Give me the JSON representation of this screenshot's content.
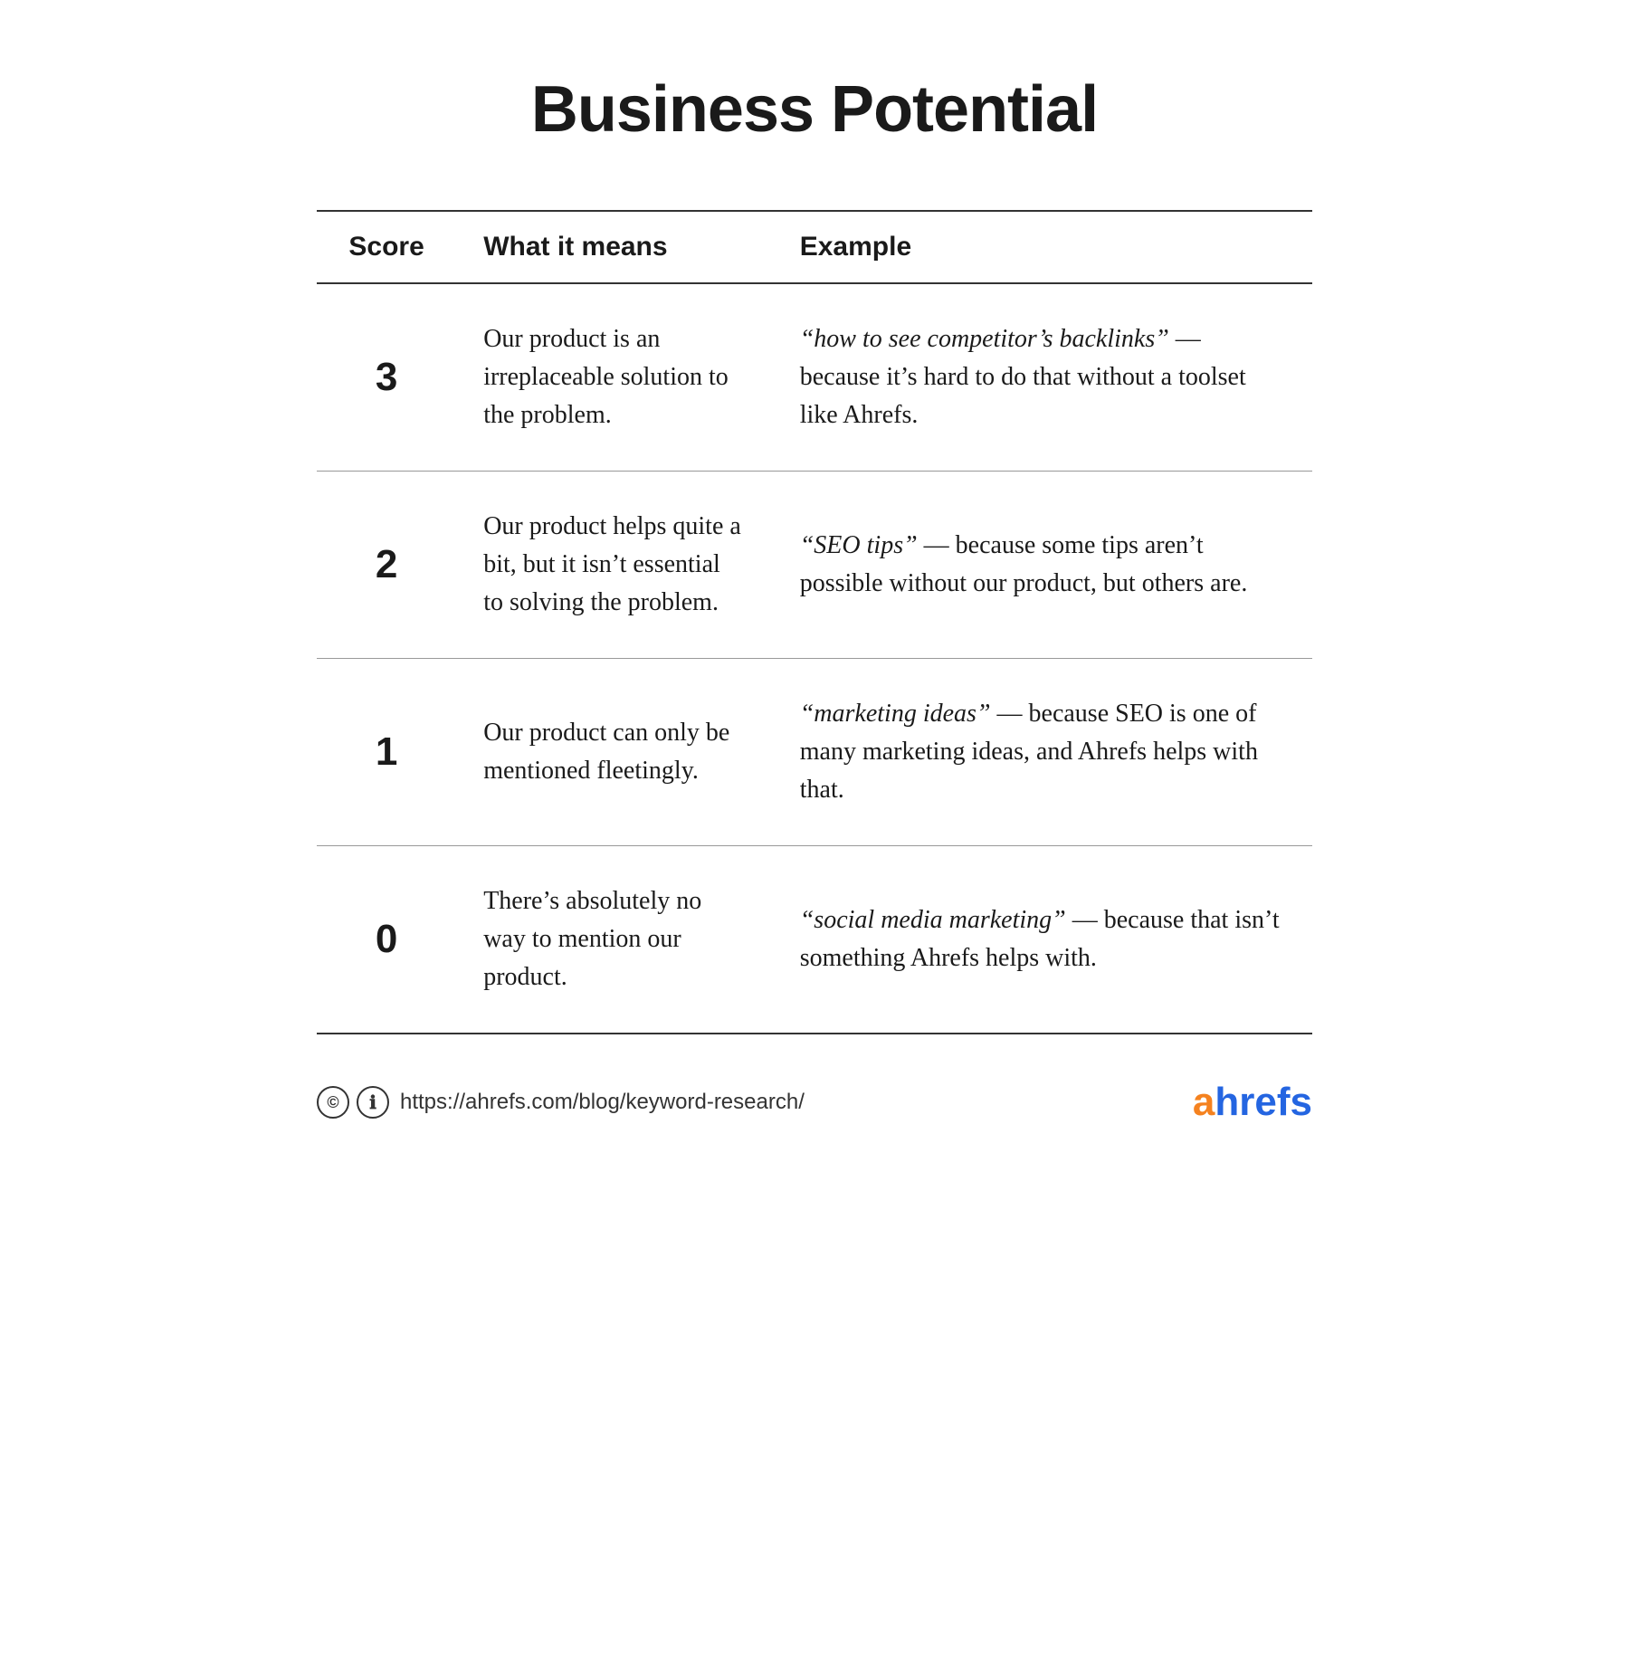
{
  "page": {
    "title": "Business Potential",
    "background_color": "#ffffff"
  },
  "table": {
    "headers": {
      "score": "Score",
      "meaning": "What it means",
      "example": "Example"
    },
    "rows": [
      {
        "score": "3",
        "meaning": "Our product is an irreplaceable solution to the problem.",
        "example_italic": "“how to see competitor’s backlinks”",
        "example_rest": " — because it’s hard to do that without a toolset like Ahrefs."
      },
      {
        "score": "2",
        "meaning": "Our product helps quite a bit, but it isn’t essential to solving the problem.",
        "example_italic": "“SEO tips”",
        "example_rest": " — because some tips aren’t possible without our product, but others are."
      },
      {
        "score": "1",
        "meaning": "Our product can only be mentioned fleetingly.",
        "example_italic": "“marketing ideas”",
        "example_rest": " — because SEO is one of many marketing ideas, and Ahrefs helps with that."
      },
      {
        "score": "0",
        "meaning": "There’s absolutely no way to mention our product.",
        "example_italic": "“social media marketing”",
        "example_rest": " — because that isn’t something Ahrefs helps with."
      }
    ]
  },
  "footer": {
    "url": "https://ahrefs.com/blog/keyword-research/",
    "brand_a": "a",
    "brand_rest": "hrefs"
  }
}
